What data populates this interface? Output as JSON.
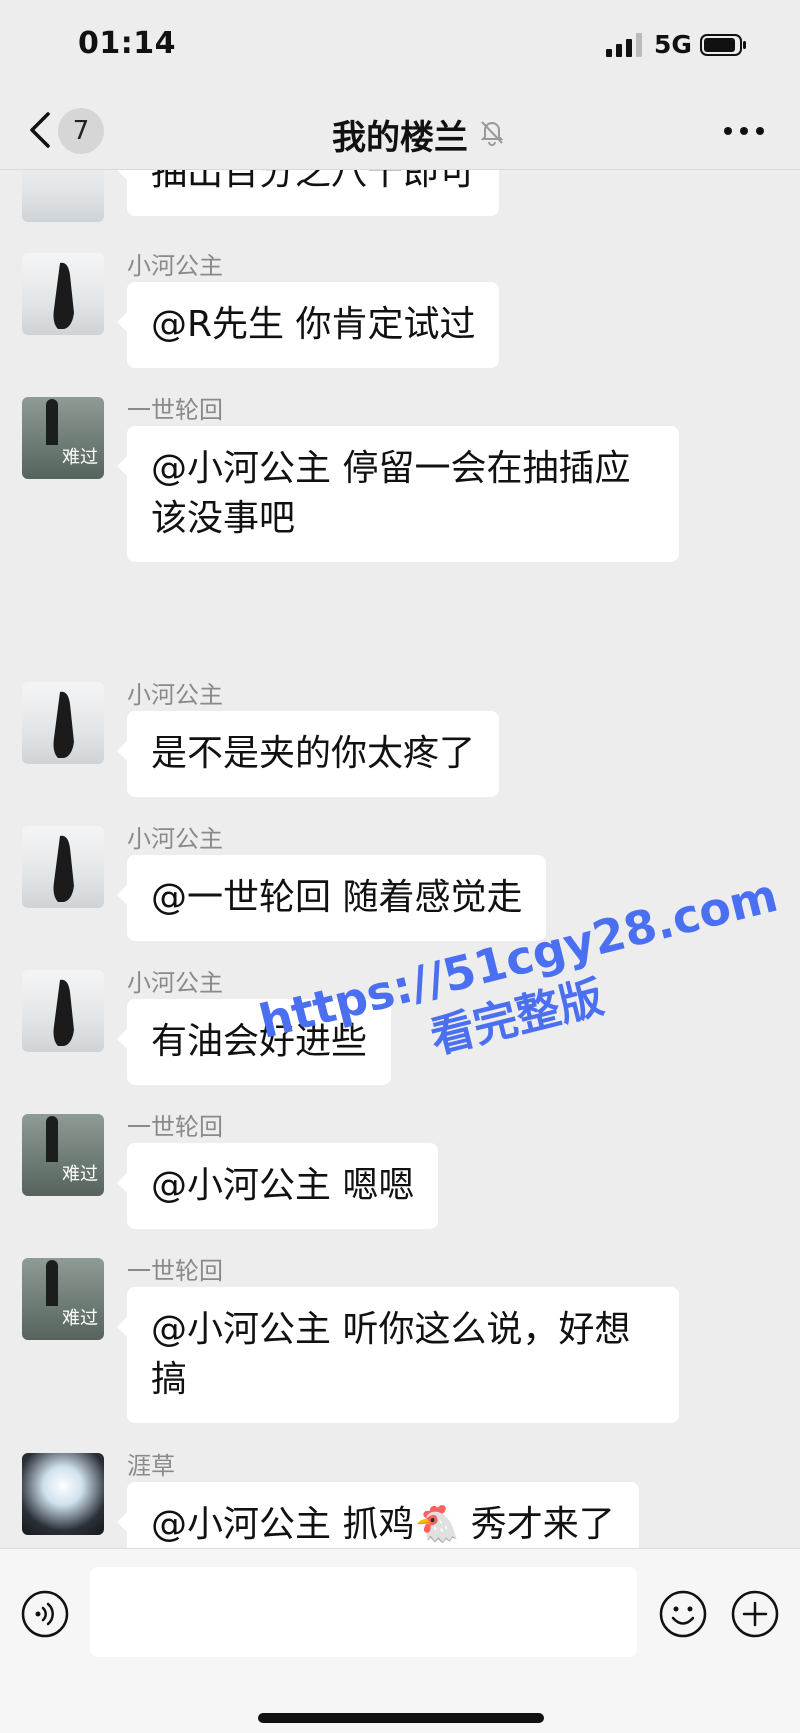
{
  "status_bar": {
    "time": "01:14",
    "network": "5G"
  },
  "nav": {
    "back_badge": "7",
    "title": "我的楼兰"
  },
  "messages": [
    {
      "sender": "",
      "text": "抽出百分之八十即可",
      "avatar": "white"
    },
    {
      "sender": "小河公主",
      "text": "@R先生 你肯定试过",
      "avatar": "white"
    },
    {
      "sender": "一世轮回",
      "text": "@小河公主 停留一会在抽插应该没事吧",
      "avatar": "dark",
      "avatar_caption": "难过"
    },
    {
      "sender": "小河公主",
      "text": "是不是夹的你太疼了",
      "avatar": "white"
    },
    {
      "sender": "小河公主",
      "text": "@一世轮回 随着感觉走",
      "avatar": "white"
    },
    {
      "sender": "小河公主",
      "text": "有油会好进些",
      "avatar": "white"
    },
    {
      "sender": "一世轮回",
      "text": "@小河公主 嗯嗯",
      "avatar": "dark",
      "avatar_caption": "难过"
    },
    {
      "sender": "一世轮回",
      "text": "@小河公主 听你这么说，好想搞",
      "avatar": "dark",
      "avatar_caption": "难过"
    },
    {
      "sender": "涯草",
      "text": "@小河公主 抓鸡🐔 秀才来了",
      "avatar": "light"
    }
  ],
  "watermark": {
    "url": "https://51cgy28.com",
    "subtitle": "看完整版"
  },
  "input": {
    "placeholder": ""
  },
  "colors": {
    "background": "#ededed",
    "bubble": "#ffffff",
    "sender_name": "#8a8a8a",
    "watermark": "#4a6ff0"
  },
  "icons": [
    "back-chevron-icon",
    "mute-bell-icon",
    "more-dots-icon",
    "voice-icon",
    "emoji-icon",
    "plus-icon",
    "signal-icon",
    "battery-icon"
  ]
}
